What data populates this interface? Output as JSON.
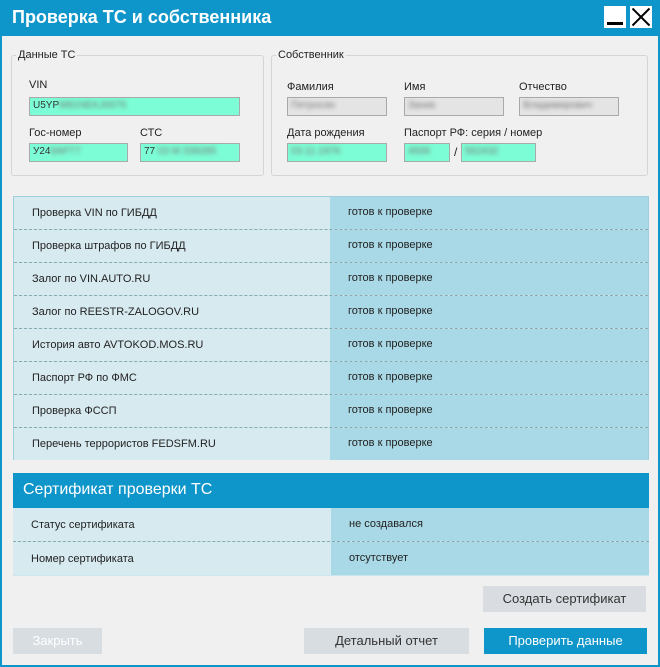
{
  "window": {
    "title": "Проверка ТС и собственника",
    "colors": {
      "accent": "#0e95c9",
      "field_filled": "#7dfdd5",
      "row_light": "#d7eaf0",
      "row_dark": "#a9d9e6"
    }
  },
  "vehicle": {
    "legend": "Данные ТС",
    "vin_label": "VIN",
    "vin_value": "U5YP",
    "vin_hidden": "M81NEKJ0075",
    "plate_label": "Гос-номер",
    "plate_value": "У24",
    "plate_hidden": "6АР77",
    "sts_label": "СТС",
    "sts_value": "77",
    "sts_hidden": "03 М 339285"
  },
  "owner": {
    "legend": "Собственник",
    "surname_label": "Фамилия",
    "surname_hidden": "Петросян",
    "name_label": "Имя",
    "name_hidden": "Заник",
    "patronymic_label": "Отчество",
    "patronymic_hidden": "Владимирович",
    "birthdate_label": "Дата рождения",
    "birthdate_hidden": "03.11.1976",
    "passport_label": "Паспорт РФ: серия / номер",
    "passport_series_hidden": "4506",
    "passport_slash": "/",
    "passport_number_hidden": "562432"
  },
  "checks": [
    {
      "name": "Проверка VIN по ГИБДД",
      "status": "готов к проверке"
    },
    {
      "name": "Проверка штрафов по ГИБДД",
      "status": "готов к проверке"
    },
    {
      "name": "Залог по VIN.AUTO.RU",
      "status": "готов к проверке"
    },
    {
      "name": "Залог по REESTR-ZALOGOV.RU",
      "status": "готов к проверке"
    },
    {
      "name": "История авто AVTOKOD.MOS.RU",
      "status": "готов к проверке"
    },
    {
      "name": "Паспорт РФ по ФМС",
      "status": "готов к проверке"
    },
    {
      "name": "Проверка ФССП",
      "status": "готов к проверке"
    },
    {
      "name": "Перечень террористов FEDSFM.RU",
      "status": "готов к проверке"
    }
  ],
  "certificate": {
    "title": "Сертификат проверки ТС",
    "rows": [
      {
        "name": "Статус сертификата",
        "value": "не создавался"
      },
      {
        "name": "Номер сертификата",
        "value": "отсутствует"
      }
    ]
  },
  "buttons": {
    "create": "Создать сертификат",
    "close": "Закрыть",
    "report": "Детальный отчет",
    "verify": "Проверить данные"
  }
}
